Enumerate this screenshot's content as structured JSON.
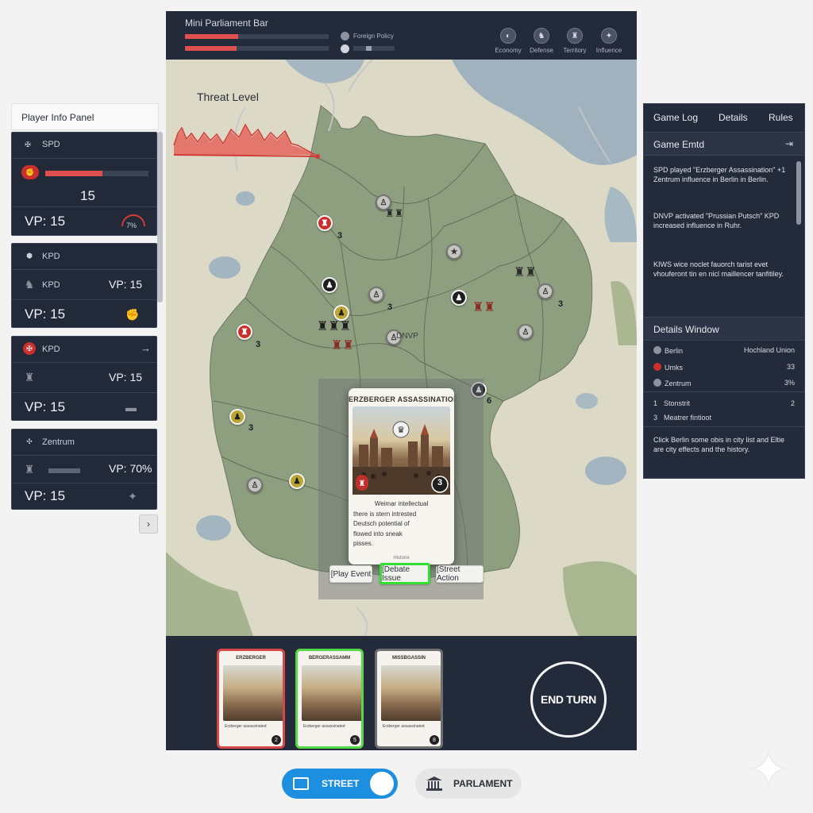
{
  "parliament": {
    "title": "Mini Parliament Bar",
    "foreign_policy_label": "Foreign Policy",
    "bars": [
      {
        "value": 0.37
      },
      {
        "value": 0.36
      }
    ],
    "policy_fill": 0.15,
    "colors": {
      "bar": "#e05050",
      "track": "#3b4356"
    }
  },
  "top_stats": [
    {
      "icon": "economy-icon",
      "label": "Economy",
      "glyph": "◐"
    },
    {
      "icon": "defense-icon",
      "label": "Defense",
      "glyph": "♞"
    },
    {
      "icon": "territory-icon",
      "label": "Territory",
      "glyph": "♜"
    },
    {
      "icon": "influence-icon",
      "label": "Influence",
      "glyph": "✦"
    }
  ],
  "map": {
    "threat_title": "Threat Level",
    "city_label": "DNVP",
    "tokens": [
      {
        "kind": "red",
        "num": "3"
      },
      {
        "kind": "grey",
        "num": ""
      },
      {
        "kind": "black",
        "num": ""
      },
      {
        "kind": "grey",
        "num": "3"
      },
      {
        "kind": "yellow",
        "num": "3"
      },
      {
        "kind": "black",
        "num": ""
      },
      {
        "kind": "red",
        "num": "3"
      },
      {
        "kind": "grey",
        "num": "3"
      },
      {
        "kind": "grey",
        "num": ""
      },
      {
        "kind": "yellow",
        "num": "3"
      },
      {
        "kind": "black",
        "num": "6"
      },
      {
        "kind": "yellow",
        "num": ""
      },
      {
        "kind": "grey",
        "num": ""
      }
    ]
  },
  "event_card": {
    "title": "ERZBERGER ASSASSINATION",
    "cost": "3",
    "text": [
      "Weimar intellectual",
      "there is stern intrested",
      "Deutsch potential of",
      "flowed into sneak",
      "pisses."
    ],
    "footer": "Historie"
  },
  "actions": [
    {
      "label": "[Play Event",
      "selected": false
    },
    {
      "label": "[Debate Issue",
      "selected": true
    },
    {
      "label": "[Street Action",
      "selected": false
    }
  ],
  "hand": [
    {
      "title": "ERZBERGER",
      "num": "2",
      "border": "#d64848",
      "text": "Erzberger assassinated"
    },
    {
      "title": "BERGERASSAMM",
      "num": "5",
      "border": "#57d64a",
      "text": "Erzberger assassinated"
    },
    {
      "title": "MISSBGASSIN",
      "num": "8",
      "border": "#6f6f6f",
      "text": "Erzberger assassinated"
    }
  ],
  "end_turn_label": "END TURN",
  "player_panel": {
    "title": "Player Info Panel",
    "players": [
      {
        "party": "SPD",
        "influence": 0.55,
        "influence_value": "15",
        "vp": "VP:  15",
        "gauge": "7%"
      },
      {
        "party": "KPD",
        "party2": "KPD",
        "vp_small": "VP: 15",
        "vp": "VP:  15"
      },
      {
        "party": "KPD",
        "vp_small": "VP: 15",
        "vp": "VP:  15"
      },
      {
        "party": "Zentrum",
        "vp_small": "VP: 70%",
        "vp": "VP:  15"
      }
    ]
  },
  "right_panel": {
    "tabs": [
      "Game Log",
      "Details",
      "Rules"
    ],
    "game_log_title": "Game Emtd",
    "log_entries": [
      "SPD played \"Erzberger Assassination\" +1 Zentrum influence in Berlin in Berlin.",
      "DNVP activated \"Prussian Putsch\" KPD increased influence in Ruhr.",
      "KIWS wice noclet fauorch tarist evet vhouferont tin en nicl maillencer tanfitiley."
    ],
    "details_title": "Details Window",
    "details": [
      {
        "name": "Berlin",
        "value": "Hochland Union"
      },
      {
        "name": "Umks",
        "value": "33"
      },
      {
        "name": "Zentrum",
        "value": "3%"
      },
      {
        "name": "Stonstrit",
        "value": "2"
      },
      {
        "name": "Meatrer fintioot",
        "value": ""
      }
    ],
    "details_nums": [
      "1",
      "3"
    ],
    "detail_footer": "Click Berlin some obis in city list and Eltie are city effects and the history."
  },
  "modes": {
    "street_label": "STREET",
    "parliament_label": "PARLAMENT"
  }
}
